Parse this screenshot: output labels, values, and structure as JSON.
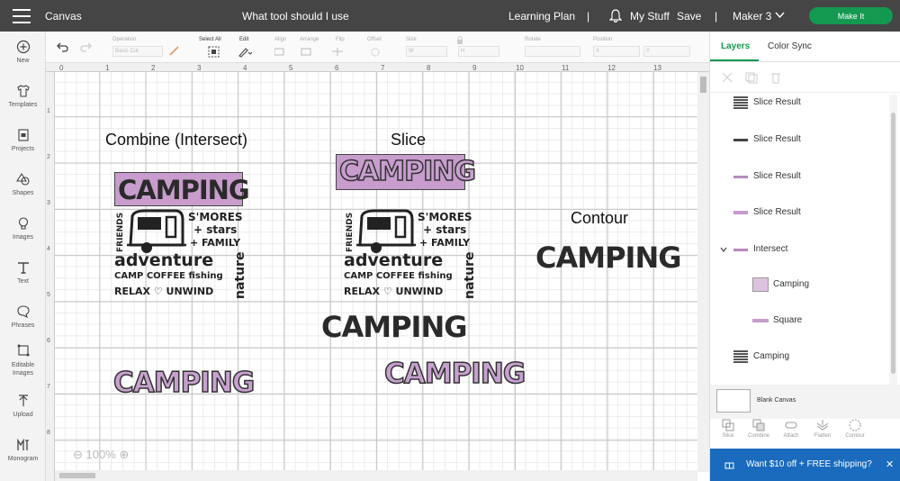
{
  "header": {
    "app_title": "Canvas",
    "project_name": "What tool should I use",
    "learning_plan": "Learning Plan",
    "my_stuff": "My Stuff",
    "save": "Save",
    "machine": "Maker 3",
    "make_it": "Make It"
  },
  "sidebar": {
    "items": [
      {
        "label": "New",
        "icon": "plus-circle-icon"
      },
      {
        "label": "Templates",
        "icon": "shirt-icon"
      },
      {
        "label": "Projects",
        "icon": "projects-icon"
      },
      {
        "label": "Shapes",
        "icon": "shapes-icon"
      },
      {
        "label": "Images",
        "icon": "bulb-icon"
      },
      {
        "label": "Text",
        "icon": "text-icon"
      },
      {
        "label": "Phrases",
        "icon": "chat-icon"
      },
      {
        "label": "Editable Images",
        "icon": "edit-image-icon"
      },
      {
        "label": "Upload",
        "icon": "upload-icon"
      },
      {
        "label": "Monogram",
        "icon": "monogram-icon"
      }
    ]
  },
  "toolbar": {
    "operation_label": "Operation",
    "operation_value": "Basic Cut",
    "select_all": "Select All",
    "edit": "Edit",
    "align": "Align",
    "arrange": "Arrange",
    "flip": "Flip",
    "offset": "Offset",
    "size": "Size",
    "size_w": "W",
    "size_h": "H",
    "rotate": "Rotate",
    "position": "Position",
    "pos_x": "X",
    "pos_y": "Y"
  },
  "canvas": {
    "ruler_h": [
      "0",
      "1",
      "2",
      "3",
      "4",
      "5",
      "6",
      "7",
      "8",
      "9",
      "10",
      "11",
      "12",
      "13"
    ],
    "ruler_v": [
      "1",
      "2",
      "3",
      "4",
      "5",
      "6",
      "7",
      "8"
    ],
    "labels": {
      "combine": "Combine (Intersect)",
      "slice": "Slice",
      "contour": "Contour"
    },
    "design": {
      "camping": "CAMPING",
      "friends": "FRIENDS",
      "smores": "S'MORES",
      "stars": "+ stars",
      "family": "+ FAMILY",
      "adventure": "adventure",
      "camp_coffee": "CAMP COFFEE fishing",
      "relax": "RELAX ♡ UNWIND",
      "nature": "nature"
    },
    "zoom": "100%"
  },
  "panel": {
    "tabs": [
      "Layers",
      "Color Sync"
    ],
    "layers": [
      {
        "name": "Slice Result",
        "thumb": "design"
      },
      {
        "name": "Slice Result",
        "thumb": "camping-black"
      },
      {
        "name": "Slice Result",
        "thumb": "camping-purple"
      },
      {
        "name": "Slice Result",
        "thumb": "bar-purple"
      },
      {
        "name": "Intersect",
        "thumb": "camping-purple"
      },
      {
        "name": "Camping",
        "thumb": "camping-purple"
      },
      {
        "name": "Square",
        "thumb": "bar-purple"
      },
      {
        "name": "Camping",
        "thumb": "design"
      }
    ],
    "blank_canvas": "Blank Canvas",
    "actions": [
      "Slice",
      "Combine",
      "Attach",
      "Flatten",
      "Contour"
    ],
    "promo": "Want $10 off + FREE shipping?"
  },
  "colors": {
    "header_bg": "#454545",
    "make_it": "#139950",
    "accent": "#139950",
    "purple": "#c89ccd",
    "promo": "#1a6bbd"
  }
}
